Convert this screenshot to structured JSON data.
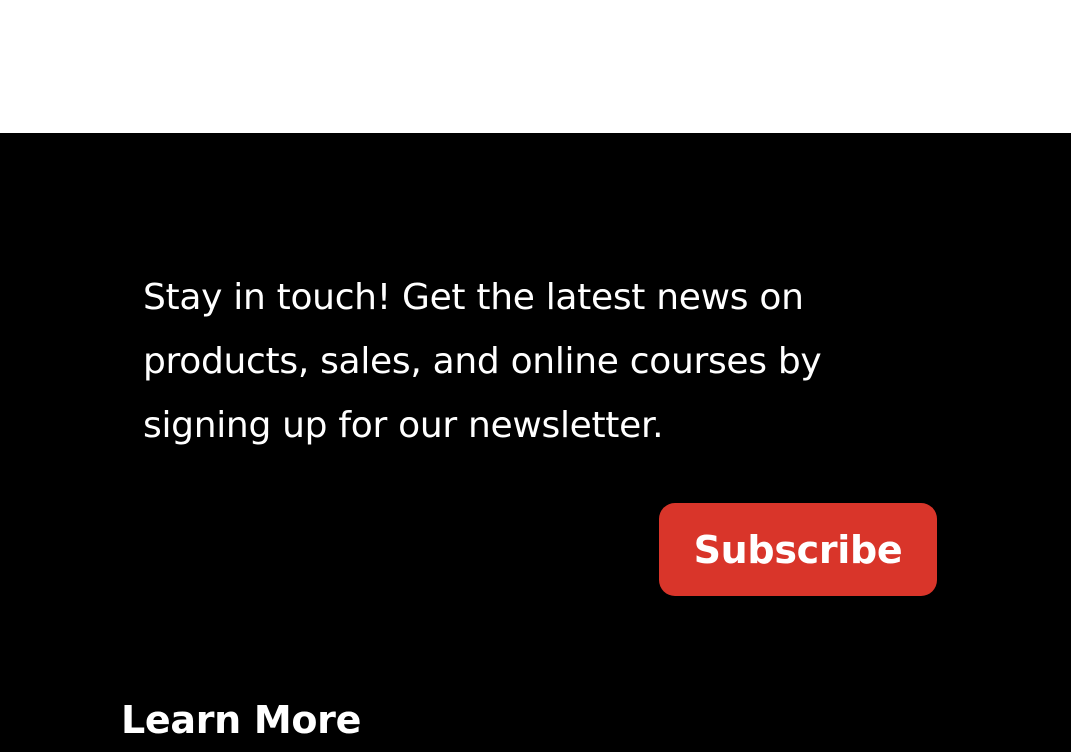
{
  "newsletter": {
    "text": "Stay in touch! Get the latest news on products, sales, and online courses by signing up for our newsletter.",
    "subscribe_label": "Subscribe"
  },
  "learn_more": {
    "heading": "Learn More"
  },
  "colors": {
    "background_top": "#ffffff",
    "footer_background": "#000000",
    "text": "#ffffff",
    "button_background": "#d9352a"
  }
}
